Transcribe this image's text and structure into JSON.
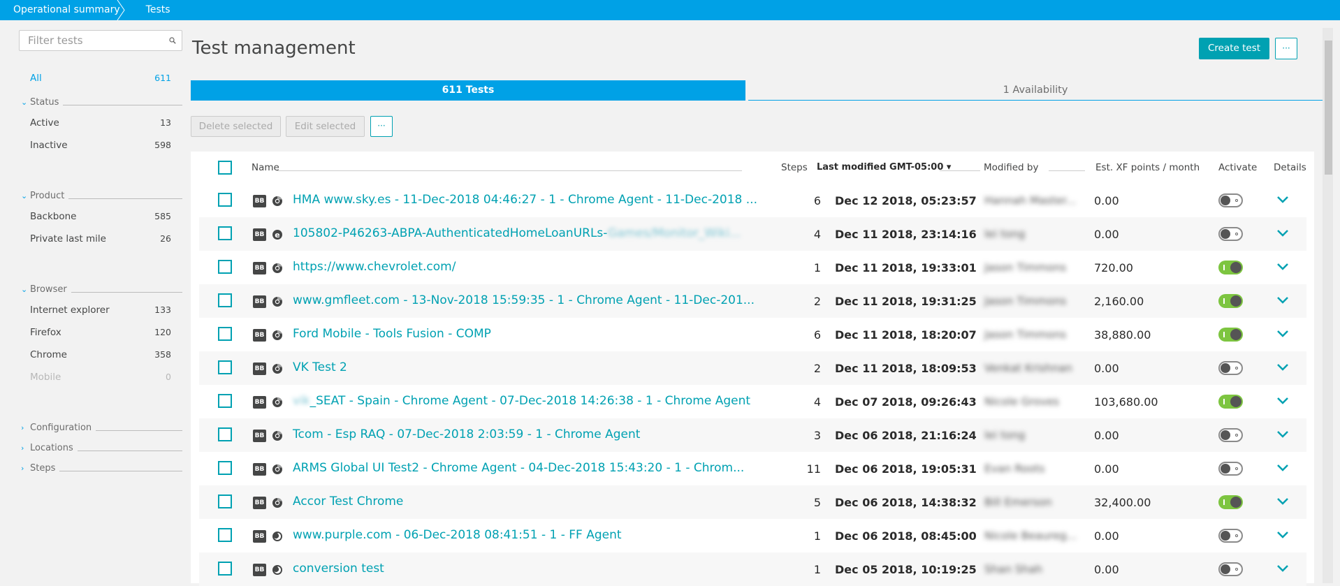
{
  "breadcrumb": [
    "Operational summary",
    "Tests"
  ],
  "sidebar": {
    "filter_placeholder": "Filter tests",
    "all": {
      "label": "All",
      "count": "611"
    },
    "groups": [
      {
        "title": "Status",
        "items": [
          {
            "label": "Active",
            "count": "13"
          },
          {
            "label": "Inactive",
            "count": "598"
          }
        ]
      },
      {
        "title": "Product",
        "items": [
          {
            "label": "Backbone",
            "count": "585"
          },
          {
            "label": "Private last mile",
            "count": "26"
          }
        ]
      },
      {
        "title": "Browser",
        "items": [
          {
            "label": "Internet explorer",
            "count": "133"
          },
          {
            "label": "Firefox",
            "count": "120"
          },
          {
            "label": "Chrome",
            "count": "358"
          },
          {
            "label": "Mobile",
            "count": "0"
          }
        ]
      }
    ],
    "collapsed": [
      "Configuration",
      "Locations",
      "Steps"
    ]
  },
  "main": {
    "title": "Test management",
    "create_label": "Create test",
    "more_label": "···",
    "tabs": [
      "611 Tests",
      "1 Availability"
    ],
    "delete_label": "Delete selected",
    "edit_label": "Edit selected",
    "actions_label": "···"
  },
  "table": {
    "headers": {
      "name": "Name",
      "steps": "Steps",
      "modified": "Last modified GMT-05:00 ▾",
      "modified_by": "Modified by",
      "points": "Est. XF points / month",
      "activate": "Activate",
      "details": "Details"
    },
    "rows": [
      {
        "badge": "BB",
        "browser": "chrome",
        "name": "HMA www.sky.es - 11-Dec-2018 04:46:27 - 1 - Chrome Agent - 11-Dec-2018 ...",
        "name_blur": "",
        "steps": "6",
        "modified": "Dec 12 2018, 05:23:57",
        "modified_by": "Hannah Master...",
        "points": "0.00",
        "active": false
      },
      {
        "badge": "BB",
        "browser": "ie",
        "name": "105802-P46263-ABPA-AuthenticatedHomeLoanURLs-",
        "name_blur": "Games/Monitor_Wiki...",
        "steps": "4",
        "modified": "Dec 11 2018, 23:14:16",
        "modified_by": "lei tong",
        "points": "0.00",
        "active": false
      },
      {
        "badge": "BB",
        "browser": "chrome",
        "name": "https://www.chevrolet.com/",
        "name_blur": "",
        "steps": "1",
        "modified": "Dec 11 2018, 19:33:01",
        "modified_by": "Jason Timmons",
        "points": "720.00",
        "active": true
      },
      {
        "badge": "BB",
        "browser": "chrome",
        "name": "www.gmfleet.com - 13-Nov-2018 15:59:35 - 1 - Chrome Agent - 11-Dec-201...",
        "name_blur": "",
        "steps": "2",
        "modified": "Dec 11 2018, 19:31:25",
        "modified_by": "Jason Timmons",
        "points": "2,160.00",
        "active": true
      },
      {
        "badge": "BB",
        "browser": "chrome",
        "name": "Ford Mobile - Tools Fusion - COMP",
        "name_blur": "",
        "steps": "6",
        "modified": "Dec 11 2018, 18:20:07",
        "modified_by": "Jason Timmons",
        "points": "38,880.00",
        "active": true
      },
      {
        "badge": "BB",
        "browser": "chrome",
        "name": "VK Test 2",
        "name_blur": "",
        "steps": "2",
        "modified": "Dec 11 2018, 18:09:53",
        "modified_by": "Venkat Krishnan",
        "points": "0.00",
        "active": false
      },
      {
        "badge": "BB",
        "browser": "chrome",
        "name_prefix_blur": "vik",
        "name": "_SEAT - Spain - Chrome Agent - 07-Dec-2018 14:26:38 - 1 - Chrome Agent",
        "name_blur": "",
        "steps": "4",
        "modified": "Dec 07 2018, 09:26:43",
        "modified_by": "Nicole Groves",
        "points": "103,680.00",
        "active": true
      },
      {
        "badge": "BB",
        "browser": "chrome",
        "name": "Tcom - Esp RAQ - 07-Dec-2018 2:03:59 - 1 - Chrome Agent",
        "name_blur": "",
        "steps": "3",
        "modified": "Dec 06 2018, 21:16:24",
        "modified_by": "lei tong",
        "points": "0.00",
        "active": false
      },
      {
        "badge": "BB",
        "browser": "chrome",
        "name": "ARMS Global UI Test2 - Chrome Agent - 04-Dec-2018 15:43:20 - 1 - Chrom...",
        "name_blur": "",
        "steps": "11",
        "modified": "Dec 06 2018, 19:05:31",
        "modified_by": "Evan Roots",
        "points": "0.00",
        "active": false
      },
      {
        "badge": "BB",
        "browser": "chrome",
        "name": "Accor Test Chrome",
        "name_blur": "",
        "steps": "5",
        "modified": "Dec 06 2018, 14:38:32",
        "modified_by": "Bill Emerson",
        "points": "32,400.00",
        "active": true
      },
      {
        "badge": "BB",
        "browser": "firefox",
        "name": "www.purple.com - 06-Dec-2018 08:41:51 - 1 - FF Agent",
        "name_blur": "",
        "steps": "1",
        "modified": "Dec 06 2018, 08:45:00",
        "modified_by": "Nicole Beaureg...",
        "points": "0.00",
        "active": false
      },
      {
        "badge": "BB",
        "browser": "firefox",
        "name": "conversion test",
        "name_blur": "",
        "steps": "1",
        "modified": "Dec 05 2018, 10:19:25",
        "modified_by": "Shan Shah",
        "points": "0.00",
        "active": false
      }
    ]
  },
  "colors": {
    "accent": "#00a1e6",
    "teal": "#00a1b2",
    "toggle_on": "#7dc540"
  }
}
